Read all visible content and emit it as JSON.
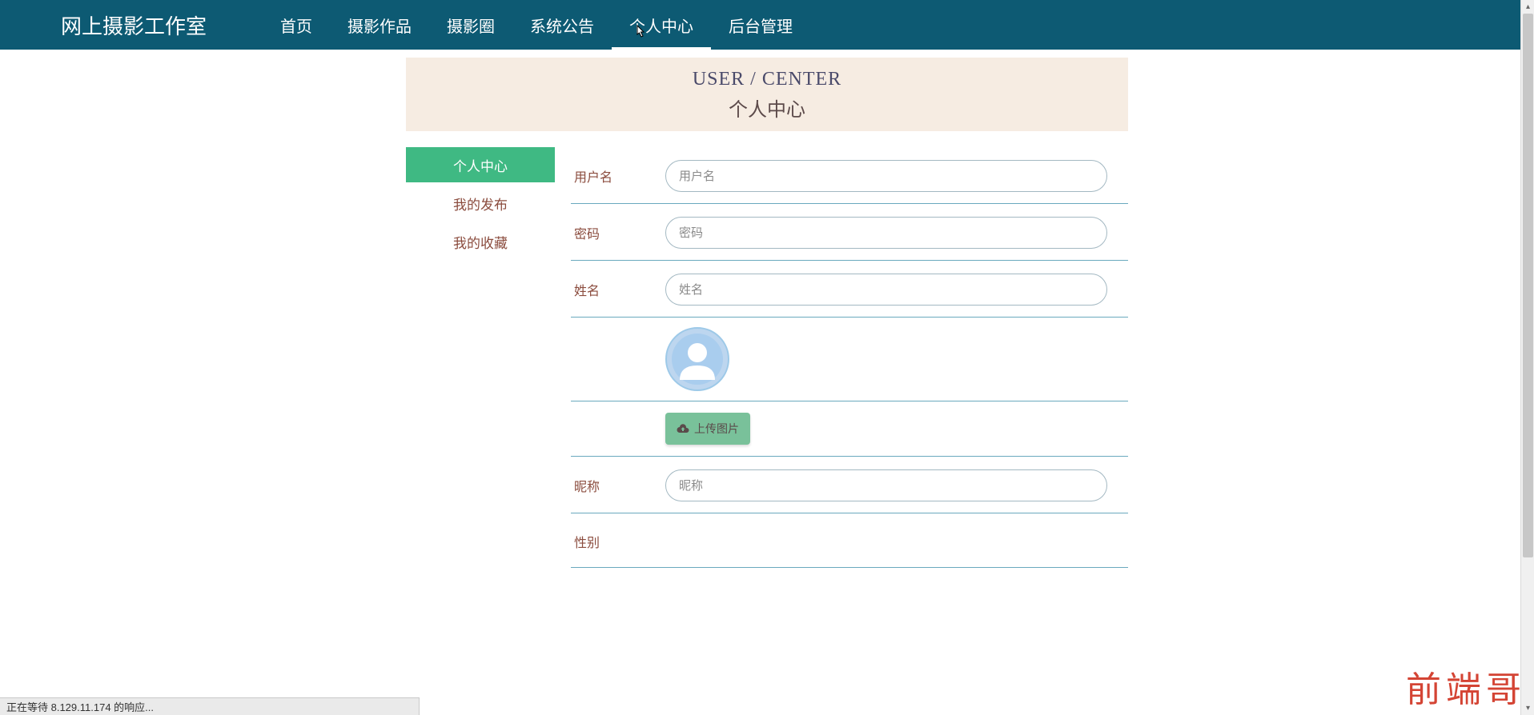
{
  "brand": "网上摄影工作室",
  "nav": {
    "items": [
      {
        "label": "首页"
      },
      {
        "label": "摄影作品"
      },
      {
        "label": "摄影圈"
      },
      {
        "label": "系统公告"
      },
      {
        "label": "个人中心"
      },
      {
        "label": "后台管理"
      }
    ],
    "activeIndex": 4
  },
  "header": {
    "title_en": "USER / CENTER",
    "title_zh": "个人中心"
  },
  "sidebar": {
    "items": [
      {
        "label": "个人中心"
      },
      {
        "label": "我的发布"
      },
      {
        "label": "我的收藏"
      }
    ],
    "activeIndex": 0
  },
  "form": {
    "username": {
      "label": "用户名",
      "placeholder": "用户名",
      "value": ""
    },
    "password": {
      "label": "密码",
      "placeholder": "密码",
      "value": ""
    },
    "realname": {
      "label": "姓名",
      "placeholder": "姓名",
      "value": ""
    },
    "upload": {
      "label": "上传图片"
    },
    "nickname": {
      "label": "昵称",
      "placeholder": "昵称",
      "value": ""
    },
    "gender": {
      "label": "性别"
    }
  },
  "watermark": "前端哥",
  "statusbar": "正在等待 8.129.11.174 的响应...",
  "icons": {
    "cloud_upload": "cloud-upload-icon",
    "avatar": "avatar-icon"
  }
}
